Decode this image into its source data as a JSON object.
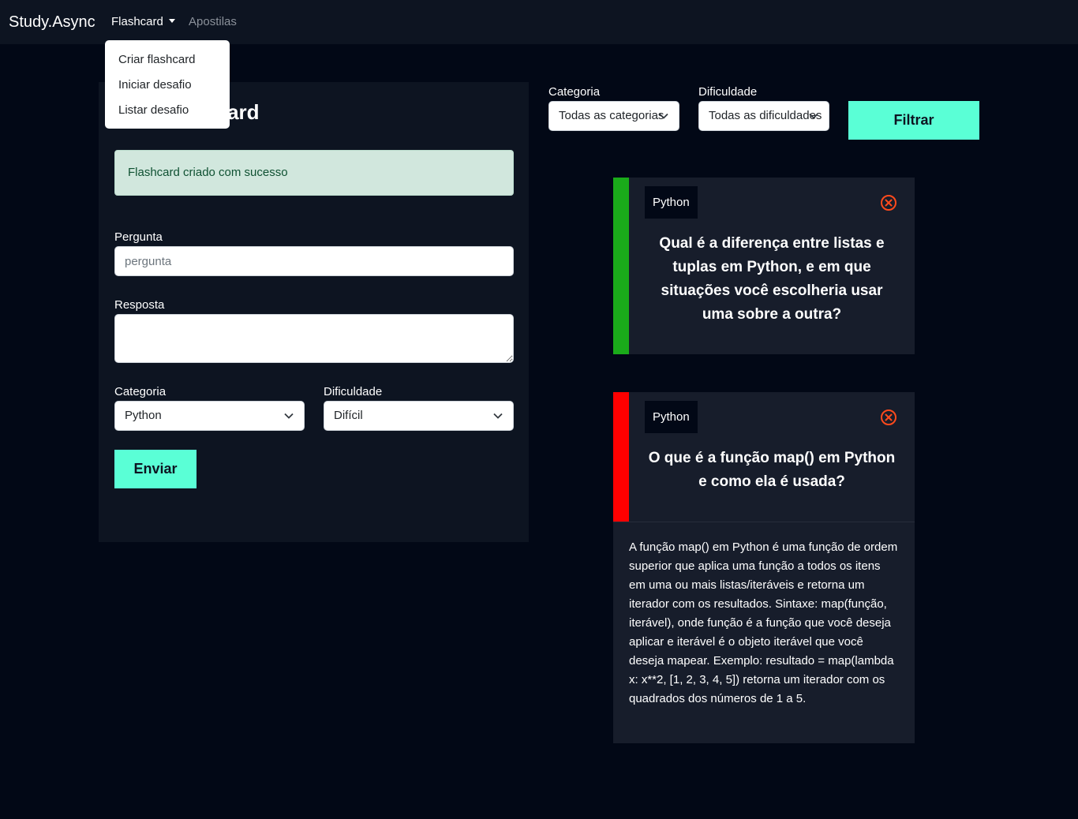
{
  "navbar": {
    "brand": "Study.Async",
    "items": [
      {
        "label": "Flashcard"
      },
      {
        "label": "Apostilas"
      }
    ]
  },
  "dropdown": {
    "items": [
      {
        "label": "Criar flashcard"
      },
      {
        "label": "Iniciar desafio"
      },
      {
        "label": "Listar desafio"
      }
    ]
  },
  "create_form": {
    "title": "Criar flashcard",
    "alert": "Flashcard criado com sucesso",
    "pergunta_label": "Pergunta",
    "pergunta_placeholder": "pergunta",
    "pergunta_value": "",
    "resposta_label": "Resposta",
    "resposta_value": "",
    "categoria_label": "Categoria",
    "categoria_value": "Python",
    "dificuldade_label": "Dificuldade",
    "dificuldade_value": "Difícil",
    "submit_label": "Enviar"
  },
  "filters": {
    "categoria_label": "Categoria",
    "categoria_value": "Todas as categorias",
    "dificuldade_label": "Dificuldade",
    "dificuldade_value": "Todas as dificuldades",
    "filter_button": "Filtrar"
  },
  "flashcards": [
    {
      "category": "Python",
      "difficulty_color": "#1aab1a",
      "question": "Qual é a diferença entre listas e tuplas em Python, e em que situações você escolheria usar uma sobre a outra?",
      "answer": ""
    },
    {
      "category": "Python",
      "difficulty_color": "#ff0000",
      "question": "O que é a função map() em Python e como ela é usada?",
      "answer": "A função map() em Python é uma função de ordem superior que aplica uma função a todos os itens em uma ou mais listas/iteráveis e retorna um iterador com os resultados. Sintaxe: map(função, iterável), onde função é a função que você deseja aplicar e iterável é o objeto iterável que você deseja mapear. Exemplo: resultado = map(lambda x: x**2, [1, 2, 3, 4, 5]) retorna um iterador com os quadrados dos números de 1 a 5."
    }
  ],
  "colors": {
    "background": "#020816",
    "navbar": "#0d1421",
    "panel": "#0d1421",
    "card": "#171d2b",
    "accent": "#5affd6",
    "close_icon": "#ff4a1c",
    "alert_bg": "#d1e7dd"
  },
  "icons": {
    "dropdown_caret": "caret-down-icon",
    "select_chevron": "chevron-down-icon",
    "card_close": "close-circle-icon"
  }
}
